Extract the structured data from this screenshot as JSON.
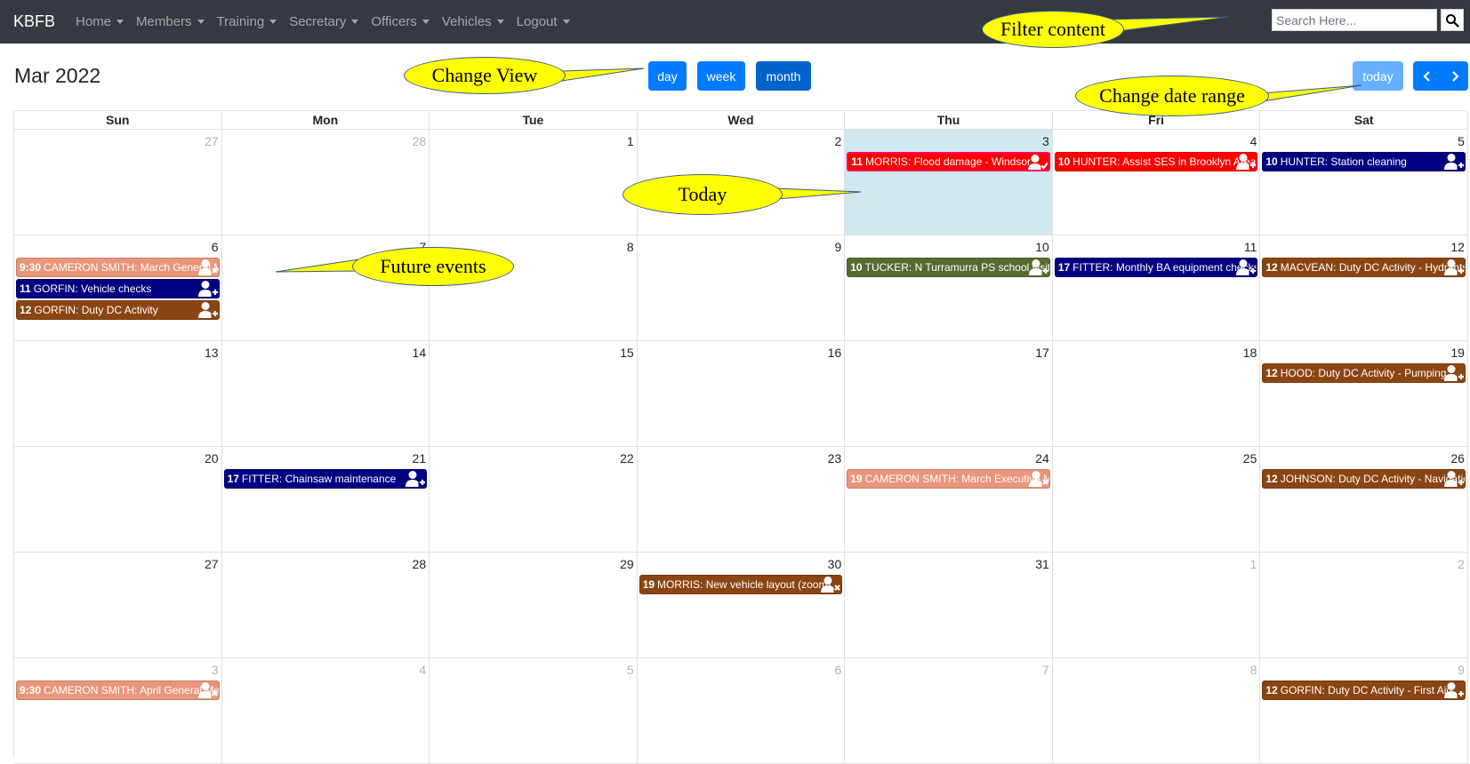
{
  "navbar": {
    "brand": "KBFB",
    "items": [
      {
        "label": "Home"
      },
      {
        "label": "Members"
      },
      {
        "label": "Training"
      },
      {
        "label": "Secretary"
      },
      {
        "label": "Officers"
      },
      {
        "label": "Vehicles"
      },
      {
        "label": "Logout"
      }
    ],
    "search_placeholder": "Search Here...",
    "search_icon": "search-icon"
  },
  "calendar": {
    "title": "Mar 2022",
    "view_buttons": {
      "day": "day",
      "week": "week",
      "month": "month"
    },
    "active_view": "month",
    "today_label": "today",
    "prev_icon": "chevron-left-icon",
    "next_icon": "chevron-right-icon",
    "dow": [
      "Sun",
      "Mon",
      "Tue",
      "Wed",
      "Thu",
      "Fri",
      "Sat"
    ],
    "weeks": [
      [
        "27",
        "28",
        "1",
        "2",
        "3",
        "4",
        "5"
      ],
      [
        "6",
        "7",
        "8",
        "9",
        "10",
        "11",
        "12"
      ],
      [
        "13",
        "14",
        "15",
        "16",
        "17",
        "18",
        "19"
      ],
      [
        "20",
        "21",
        "22",
        "23",
        "24",
        "25",
        "26"
      ],
      [
        "27",
        "28",
        "29",
        "30",
        "31",
        "1",
        "2"
      ],
      [
        "3",
        "4",
        "5",
        "6",
        "7",
        "8",
        "9"
      ]
    ],
    "events": {
      "w0d4": [
        {
          "time": "11",
          "title": "MORRIS: Flood damage - Windsor"
        }
      ],
      "w0d5": [
        {
          "time": "10",
          "title": "HUNTER: Assist SES in Brooklyn Area"
        }
      ],
      "w0d6": [
        {
          "time": "10",
          "title": "HUNTER: Station cleaning"
        }
      ],
      "w1d0": [
        {
          "time": "9:30",
          "title": "CAMERON SMITH: March General Meeting"
        },
        {
          "time": "11",
          "title": "GORFIN: Vehicle checks"
        },
        {
          "time": "12",
          "title": "GORFIN: Duty DC Activity"
        }
      ],
      "w1d4": [
        {
          "time": "10",
          "title": "TUCKER: N Turramurra PS school visit"
        }
      ],
      "w1d5": [
        {
          "time": "17",
          "title": "FITTER: Monthly BA equipment checks"
        }
      ],
      "w1d6": [
        {
          "time": "12",
          "title": "MACVEAN: Duty DC Activity - Hydrants"
        }
      ],
      "w2d6": [
        {
          "time": "12",
          "title": "HOOD: Duty DC Activity - Pumping"
        }
      ],
      "w3d1": [
        {
          "time": "17",
          "title": "FITTER: Chainsaw maintenance"
        }
      ],
      "w3d4": [
        {
          "time": "19",
          "title": "CAMERON SMITH: March Executive Meeting"
        }
      ],
      "w3d6": [
        {
          "time": "12",
          "title": "JOHNSON: Duty DC Activity - Navigation"
        }
      ],
      "w4d3": [
        {
          "time": "19",
          "title": "MORRIS: New vehicle layout (zoom)"
        }
      ],
      "w5d0": [
        {
          "time": "9:30",
          "title": "CAMERON SMITH: April General Meeting"
        }
      ],
      "w5d6": [
        {
          "time": "12",
          "title": "GORFIN: Duty DC Activity - First Aid"
        }
      ]
    }
  },
  "callouts": {
    "filter": "Filter content",
    "view": "Change View",
    "range": "Change date range",
    "today": "Today",
    "future": "Future events"
  }
}
